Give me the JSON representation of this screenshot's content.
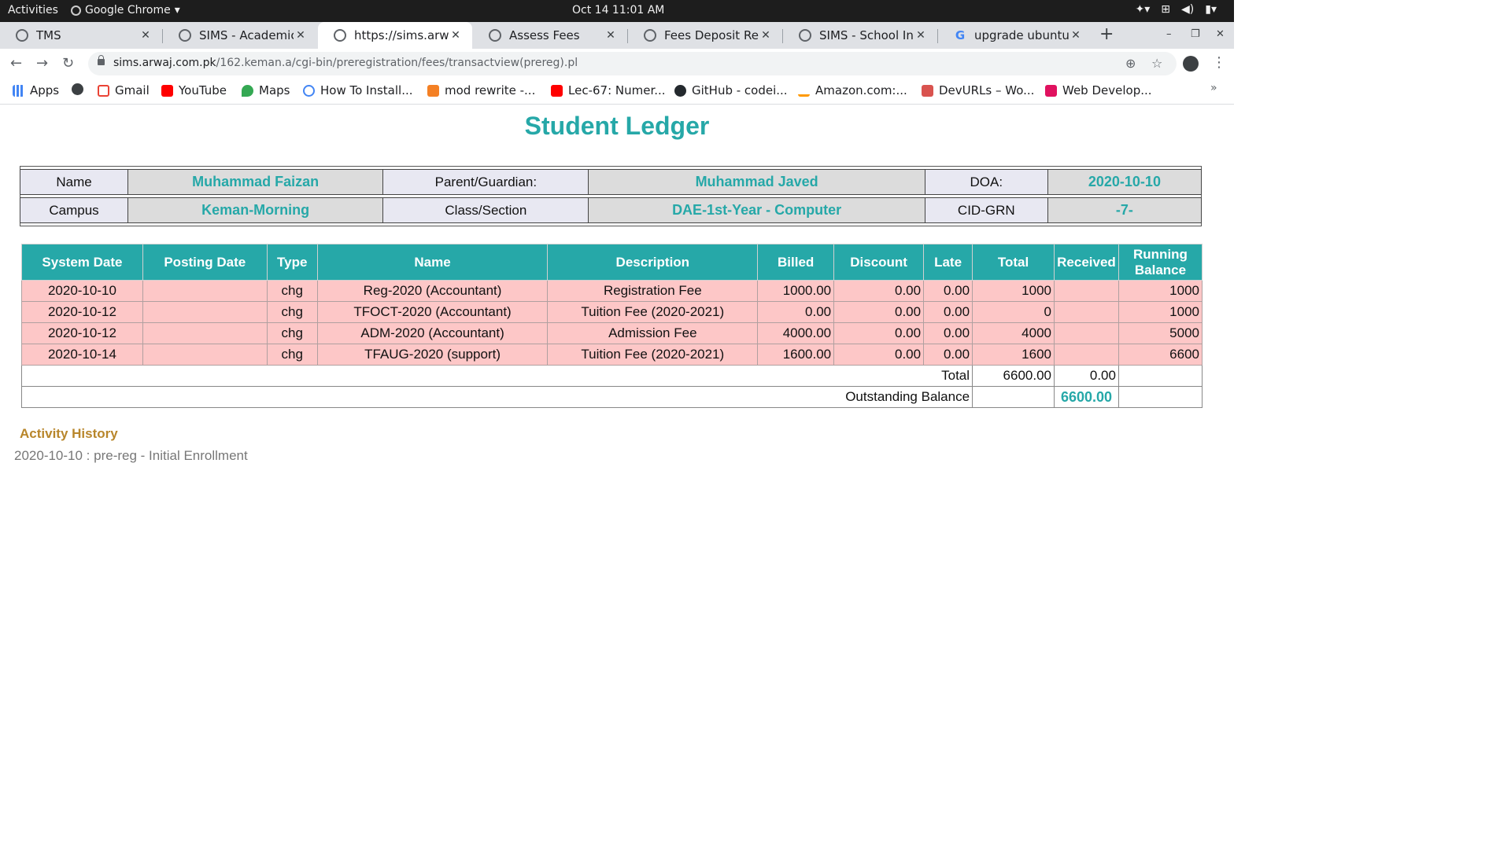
{
  "system_bar": {
    "activities": "Activities",
    "app_name": "Google Chrome",
    "clock": "Oct 14  11:01 AM"
  },
  "browser": {
    "tabs": [
      {
        "title": "TMS",
        "active": false
      },
      {
        "title": "SIMS - Academic",
        "active": false
      },
      {
        "title": "https://sims.arwaj.com.pk",
        "active": true
      },
      {
        "title": "Assess Fees",
        "active": false
      },
      {
        "title": "Fees Deposit Report",
        "active": false
      },
      {
        "title": "SIMS - School Information",
        "active": false
      },
      {
        "title": "upgrade ubuntu from",
        "active": false
      }
    ],
    "new_tab": "+",
    "url_host": "sims.arwaj.com.pk",
    "url_path": "/162.keman.a/cgi-bin/preregistration/fees/transactview(prereg).pl",
    "bookmarks": [
      {
        "label": "Apps",
        "icon": "apps-grid-icon"
      },
      {
        "label": "",
        "icon": "globe-icon"
      },
      {
        "label": "Gmail",
        "icon": "gmail-icon"
      },
      {
        "label": "YouTube",
        "icon": "youtube-icon"
      },
      {
        "label": "Maps",
        "icon": "maps-icon"
      },
      {
        "label": "How To Install...",
        "icon": "loading-icon"
      },
      {
        "label": "mod rewrite -...",
        "icon": "stackoverflow-icon"
      },
      {
        "label": "Lec-67: Numer...",
        "icon": "youtube-icon"
      },
      {
        "label": "GitHub - codei...",
        "icon": "github-icon"
      },
      {
        "label": "Amazon.com:...",
        "icon": "amazon-icon"
      },
      {
        "label": "DevURLs – Wo...",
        "icon": "devurls-icon"
      },
      {
        "label": "Web Develop...",
        "icon": "web-develop-icon"
      }
    ],
    "bookmarks_more": "»"
  },
  "page": {
    "title": "Student Ledger",
    "info": {
      "name_label": "Name",
      "name_value": "Muhammad Faizan",
      "guardian_label": "Parent/Guardian:",
      "guardian_value": "Muhammad Javed",
      "doa_label": "DOA:",
      "doa_value": "2020-10-10",
      "campus_label": "Campus",
      "campus_value": "Keman-Morning",
      "class_label": "Class/Section",
      "class_value": "DAE-1st-Year - Computer",
      "cid_label": "CID-GRN",
      "cid_value": "-7-"
    },
    "ledger": {
      "headers": [
        "System Date",
        "Posting Date",
        "Type",
        "Name",
        "Description",
        "Billed",
        "Discount",
        "Late",
        "Total",
        "Received",
        "Running Balance"
      ],
      "rows": [
        {
          "system_date": "2020-10-10",
          "posting_date": "",
          "type": "chg",
          "name": "Reg-2020 (Accountant)",
          "description": "Registration Fee",
          "billed": "1000.00",
          "discount": "0.00",
          "late": "0.00",
          "total": "1000",
          "received": "",
          "running_balance": "1000"
        },
        {
          "system_date": "2020-10-12",
          "posting_date": "",
          "type": "chg",
          "name": "TFOCT-2020 (Accountant)",
          "description": "Tuition Fee (2020-2021)",
          "billed": "0.00",
          "discount": "0.00",
          "late": "0.00",
          "total": "0",
          "received": "",
          "running_balance": "1000"
        },
        {
          "system_date": "2020-10-12",
          "posting_date": "",
          "type": "chg",
          "name": "ADM-2020 (Accountant)",
          "description": "Admission Fee",
          "billed": "4000.00",
          "discount": "0.00",
          "late": "0.00",
          "total": "4000",
          "received": "",
          "running_balance": "5000"
        },
        {
          "system_date": "2020-10-14",
          "posting_date": "",
          "type": "chg",
          "name": "TFAUG-2020 (support)",
          "description": "Tuition Fee (2020-2021)",
          "billed": "1600.00",
          "discount": "0.00",
          "late": "0.00",
          "total": "1600",
          "received": "",
          "running_balance": "6600"
        }
      ],
      "total_label": "Total",
      "total_value": "6600.00",
      "total_received": "0.00",
      "outstanding_label": "Outstanding Balance",
      "outstanding_value": "6600.00"
    },
    "activity": {
      "heading": "Activity History",
      "entries": [
        "2020-10-10 : pre-reg - Initial Enrollment"
      ]
    }
  },
  "colors": {
    "accent_teal": "#26a8a8",
    "row_pink": "#fdc7c7",
    "activity_gold": "#b8862b"
  }
}
